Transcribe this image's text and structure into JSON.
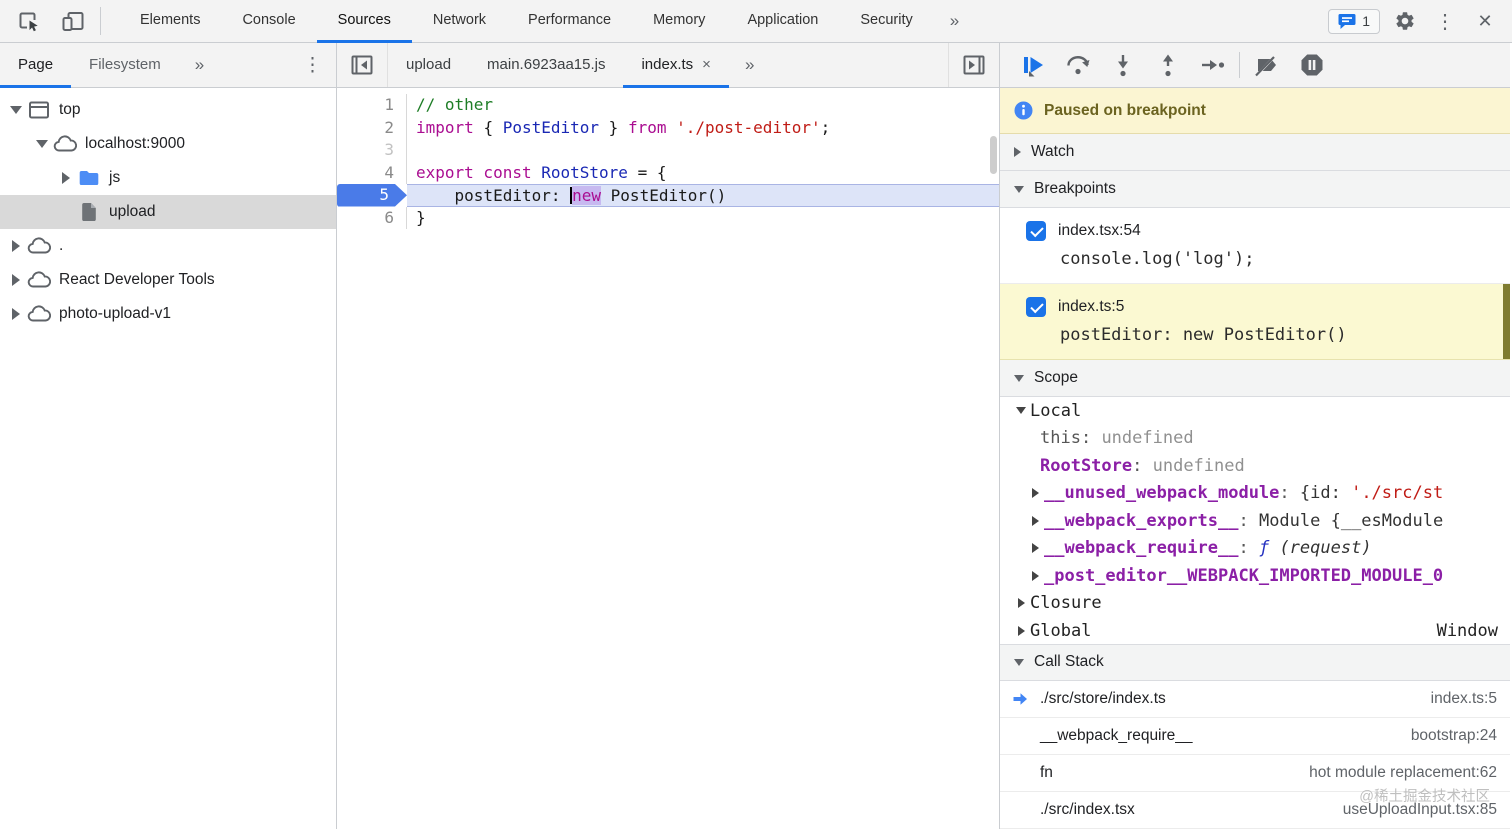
{
  "topbar": {
    "tabs": [
      {
        "label": "Elements",
        "active": false
      },
      {
        "label": "Console",
        "active": false
      },
      {
        "label": "Sources",
        "active": true
      },
      {
        "label": "Network",
        "active": false
      },
      {
        "label": "Performance",
        "active": false
      },
      {
        "label": "Memory",
        "active": false
      },
      {
        "label": "Application",
        "active": false
      },
      {
        "label": "Security",
        "active": false
      }
    ],
    "overflow_glyph": "»",
    "messages_count": "1",
    "dots_glyph": "⋮",
    "close_glyph": "✕",
    "accent_color": "#1a73e8"
  },
  "sidebar": {
    "tabs": [
      {
        "label": "Page",
        "active": true
      },
      {
        "label": "Filesystem",
        "active": false
      }
    ],
    "overflow_glyph": "»",
    "dots_glyph": "⋮",
    "tree": [
      {
        "label": "top",
        "icon": "frame-icon",
        "state": "expanded"
      },
      {
        "label": "localhost:9000",
        "icon": "cloud-icon",
        "state": "expanded"
      },
      {
        "label": "js",
        "icon": "folder-icon",
        "state": "collapsed"
      },
      {
        "label": "upload",
        "icon": "file-icon",
        "state": "selected"
      },
      {
        "label": ".",
        "icon": "cloud-icon",
        "state": "collapsed"
      },
      {
        "label": "React Developer Tools",
        "icon": "cloud-icon",
        "state": "collapsed"
      },
      {
        "label": "photo-upload-v1",
        "icon": "cloud-icon",
        "state": "collapsed"
      }
    ]
  },
  "editor": {
    "tabs": [
      {
        "label": "upload",
        "active": false
      },
      {
        "label": "main.6923aa15.js",
        "active": false
      },
      {
        "label": "index.ts",
        "active": true,
        "close_glyph": "×"
      }
    ],
    "overflow_glyph": "»",
    "code": {
      "l1_num": "1",
      "l1_comment": "// other",
      "l2_num": "2",
      "l2_kw1": "import ",
      "l2_p1": "{ ",
      "l2_def": "PostEditor",
      "l2_p2": " } ",
      "l2_kw2": "from ",
      "l2_str": "'./post-editor'",
      "l2_p3": ";",
      "l3_num": "3",
      "l4_num": "4",
      "l4_kw": "export const ",
      "l4_def": "RootStore",
      "l4_p1": " = {",
      "l5_num": "5",
      "l5_p1": "    postEditor: ",
      "l5_kw": "new",
      "l5_p2": " PostEditor()",
      "l6_num": "6",
      "l6_p1": "}"
    }
  },
  "debugger": {
    "paused_banner": "Paused on breakpoint",
    "watch": {
      "title": "Watch"
    },
    "breakpoints": {
      "title": "Breakpoints",
      "items": [
        {
          "location": "index.tsx:54",
          "snippet": "console.log('log');",
          "checked": true,
          "active": false
        },
        {
          "location": "index.ts:5",
          "snippet": "postEditor: new PostEditor()",
          "checked": true,
          "active": true
        }
      ]
    },
    "scope": {
      "title": "Scope",
      "local_label": "Local",
      "this_name": "this",
      "this_sep": ": ",
      "this_value": "undefined",
      "rootstore_name": "RootStore",
      "rootstore_sep": ": ",
      "rootstore_value": "undefined",
      "unused_name": "__unused_webpack_module",
      "unused_sep": ": ",
      "unused_val_prefix": "{id: ",
      "unused_val_string": "'./src/st",
      "exports_name": "__webpack_exports__",
      "exports_sep": ": ",
      "exports_value": "Module {__esModule",
      "require_name": "__webpack_require__",
      "require_sep": ": ",
      "require_f": "ƒ",
      "require_args": " (request)",
      "postmod_name": "_post_editor__WEBPACK_IMPORTED_MODULE_0",
      "closure_label": "Closure",
      "global_label": "Global",
      "global_value": "Window"
    },
    "call_stack": {
      "title": "Call Stack",
      "frames": [
        {
          "name": "./src/store/index.ts",
          "location": "index.ts:5",
          "active": true
        },
        {
          "name": "__webpack_require__",
          "location": "bootstrap:24",
          "active": false
        },
        {
          "name": "fn",
          "location": "hot module replacement:62",
          "active": false
        },
        {
          "name": "./src/index.tsx",
          "location": "useUploadInput.tsx:85",
          "active": false
        }
      ]
    }
  },
  "watermark": "@稀土掘金技术社区"
}
